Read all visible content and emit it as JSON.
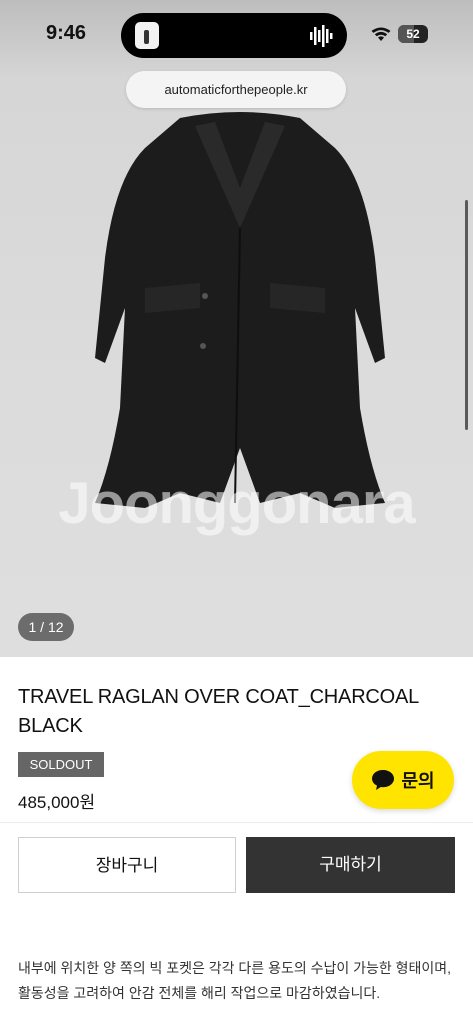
{
  "status_bar": {
    "time": "9:46",
    "battery": "52",
    "battery_level": 0.52
  },
  "browser": {
    "url": "automaticforthepeople.kr"
  },
  "product": {
    "image_counter": "1 / 12",
    "watermark": "Joonggonara",
    "title": "TRAVEL RAGLAN OVER COAT_CHARCOAL BLACK",
    "badge": "SOLDOUT",
    "price": "485,000원",
    "description": "내부에 위치한 양 쪽의 빅 포켓은 각각 다른 용도의 수납이 가능한 형태이며, 활동성을 고려하여 안감 전체를 해리 작업으로 마감하였습니다."
  },
  "actions": {
    "cart_label": "장바구니",
    "buy_label": "구매하기",
    "chat_label": "문의"
  },
  "icons": {
    "chat": "chat-bubble-icon",
    "wifi": "wifi-icon",
    "battery": "battery-icon",
    "sound": "waveform-icon"
  },
  "colors": {
    "chat_button": "#ffe400",
    "buy_button": "#333333",
    "badge": "#666666"
  }
}
